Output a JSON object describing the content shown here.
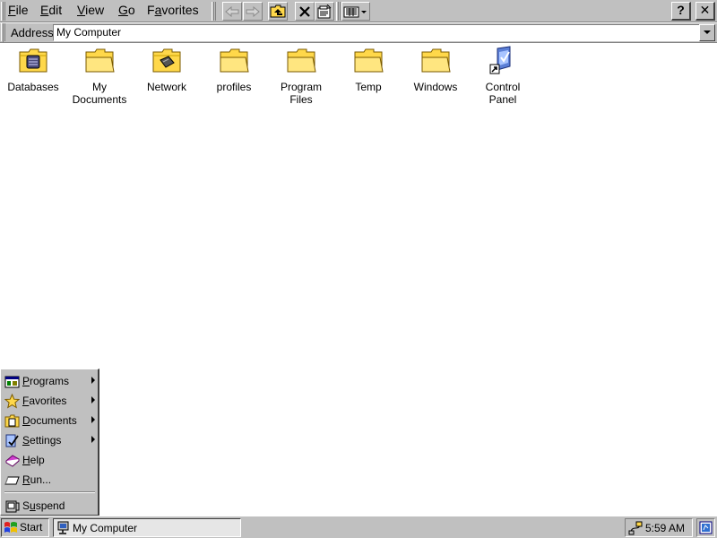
{
  "menubar": {
    "items": [
      {
        "label": "File",
        "accel": "F"
      },
      {
        "label": "Edit",
        "accel": "E"
      },
      {
        "label": "View",
        "accel": "V"
      },
      {
        "label": "Go",
        "accel": "G"
      },
      {
        "label": "Favorites",
        "accel": "a"
      }
    ]
  },
  "toolbar": {
    "buttons": [
      "back-icon",
      "forward-icon",
      "up-one-level-icon",
      "delete-icon",
      "properties-icon",
      "views-icon"
    ],
    "help_label": "?",
    "close_label": "✕"
  },
  "address": {
    "label": "Address",
    "value": "My Computer"
  },
  "icons": [
    {
      "label": "Databases",
      "icon": "databases-folder-icon"
    },
    {
      "label": "My Documents",
      "icon": "folder-icon"
    },
    {
      "label": "Network",
      "icon": "network-folder-icon"
    },
    {
      "label": "profiles",
      "icon": "folder-icon"
    },
    {
      "label": "Program Files",
      "icon": "folder-icon"
    },
    {
      "label": "Temp",
      "icon": "folder-icon"
    },
    {
      "label": "Windows",
      "icon": "folder-icon"
    },
    {
      "label": "Control Panel",
      "icon": "control-panel-shortcut-icon"
    }
  ],
  "start_menu": {
    "items": [
      {
        "label": "Programs",
        "accel": "P",
        "submenu": true
      },
      {
        "label": "Favorites",
        "accel": "F",
        "submenu": true
      },
      {
        "label": "Documents",
        "accel": "D",
        "submenu": true
      },
      {
        "label": "Settings",
        "accel": "S",
        "submenu": true
      },
      {
        "label": "Help",
        "accel": "H",
        "submenu": false
      },
      {
        "label": "Run...",
        "accel": "R",
        "submenu": false
      }
    ],
    "suspend": {
      "label": "Suspend",
      "accel": "u"
    }
  },
  "taskbar": {
    "start_label": "Start",
    "task_label": "My Computer",
    "clock": "5:59 AM"
  },
  "colors": {
    "chrome": "#c0c0c0",
    "folder_yellow": "#ffd84a",
    "workspace": "#ffffff"
  }
}
